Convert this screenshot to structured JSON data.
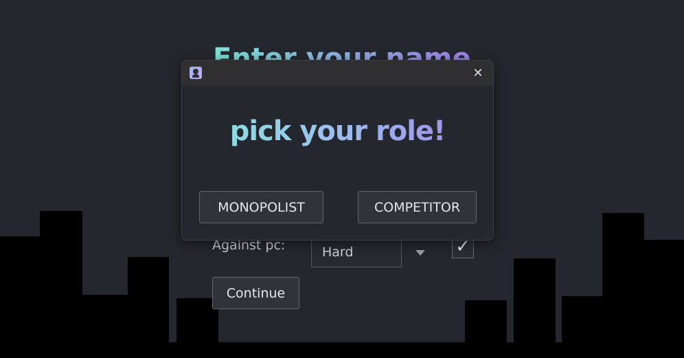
{
  "background": {
    "title": "Enter your name",
    "against_pc_label": "Against pc:",
    "difficulty_value": "Hard",
    "pc_checkbox_mark": "✓",
    "continue_label": "Continue"
  },
  "dialog": {
    "icon": "monopoly-man-icon",
    "close_glyph": "✕",
    "heading": "pick your role!",
    "monopolist_label": "MONOPOLIST",
    "competitor_label": "COMPETITOR"
  },
  "colors": {
    "background": "#24272d",
    "skyline": "#000000",
    "heading_gradient_start": "#86e6dc",
    "heading_gradient_end": "#a184e8",
    "titlebar": "#2f2f31",
    "button": "#30333a"
  }
}
